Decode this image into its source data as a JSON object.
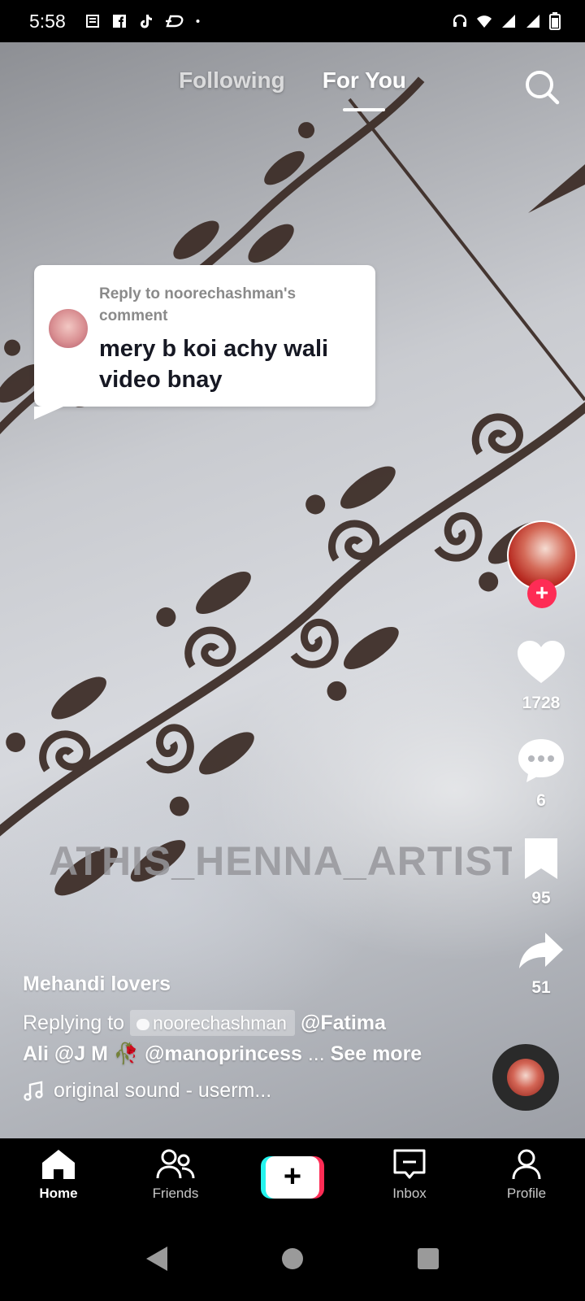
{
  "status_bar": {
    "time": "5:58",
    "left_icons": [
      "news-icon",
      "facebook-icon",
      "tiktok-icon",
      "signal-app-icon",
      "dot-icon"
    ],
    "right_icons": [
      "headphones-icon",
      "wifi-icon",
      "cell-signal-icon",
      "cell-signal-icon",
      "battery-icon"
    ]
  },
  "top_tabs": {
    "following": "Following",
    "for_you": "For You",
    "active": "For You"
  },
  "reply_card": {
    "label": "Reply to noorechashman's comment",
    "text": "mery b koi achy wali video bnay"
  },
  "watermark": "ATHIS_HENNA_ARTISTRY",
  "rail": {
    "likes": "1728",
    "comments": "6",
    "bookmarks": "95",
    "shares": "51"
  },
  "caption": {
    "author": "Mehandi lovers",
    "replying_prefix": "Replying to",
    "reply_chip": "noorechashman",
    "mentions_1": "@Fatima",
    "mentions_2": "Ali @J M",
    "mentions_3": "@manoprincess",
    "ellipsis": "...",
    "see_more": "See more",
    "sound": "original sound - userm..."
  },
  "bottom_nav": {
    "home": "Home",
    "friends": "Friends",
    "inbox": "Inbox",
    "profile": "Profile",
    "active": "Home"
  },
  "colors": {
    "accent": "#fe2c55",
    "cyan": "#25f4ee",
    "background": "#000000"
  }
}
